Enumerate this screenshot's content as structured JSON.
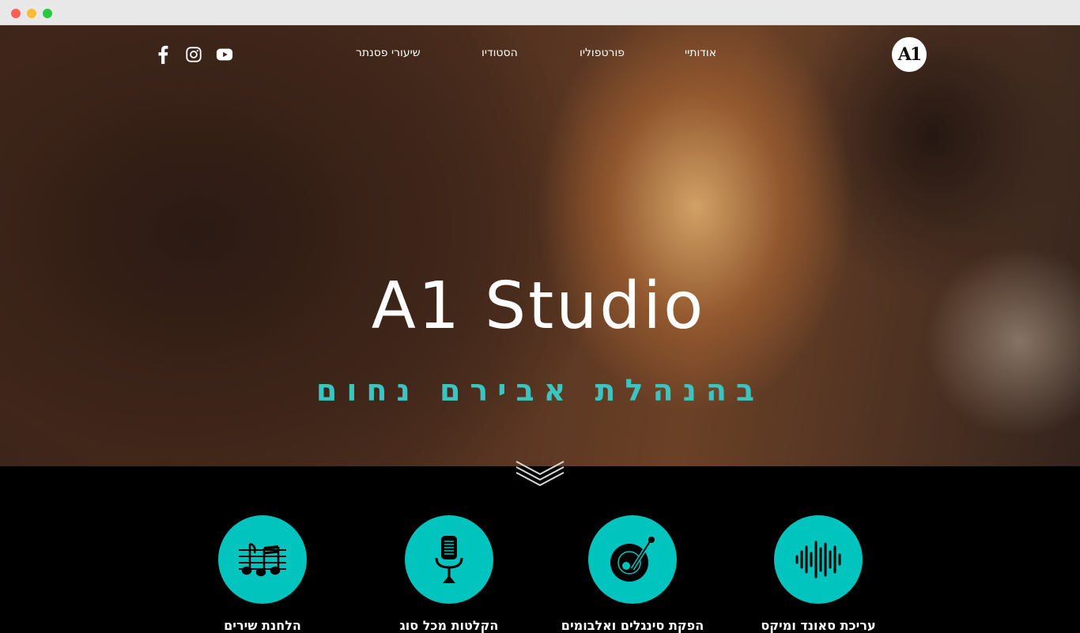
{
  "nav": {
    "items": [
      {
        "label": "אודותיי"
      },
      {
        "label": "פורטפוליו"
      },
      {
        "label": "הסטודיו"
      },
      {
        "label": "שיעורי פסנתר"
      }
    ],
    "logo_text": "A1"
  },
  "social": [
    "youtube-icon",
    "instagram-icon",
    "facebook-icon"
  ],
  "hero": {
    "title": "A1 Studio",
    "subtitle": "בהנהלת אבירם נחום"
  },
  "services": [
    {
      "label": "עריכת סאונד ומיקס",
      "icon": "sound-wave-icon"
    },
    {
      "label": "הפקת סינגלים ואלבומים",
      "icon": "vinyl-record-icon"
    },
    {
      "label": "הקלטות מכל סוג",
      "icon": "microphone-icon"
    },
    {
      "label": "הלחנת שירים",
      "icon": "music-notes-icon"
    }
  ],
  "colors": {
    "accent": "#00c4bd",
    "subtitle": "#3cc4c0",
    "background": "#000000"
  }
}
